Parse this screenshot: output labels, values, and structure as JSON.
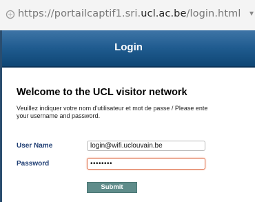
{
  "browser": {
    "url_prefix": "https://portailcaptif1.sri.",
    "url_host": "ucl.ac.be",
    "url_path": "/login.html"
  },
  "header": {
    "title": "Login"
  },
  "welcome": {
    "heading": "Welcome to the UCL visitor network",
    "instructions_line1": "Veuillez indiquer votre nom d'utilisateur et mot de passe / Please ente",
    "instructions_line2": "your username and password."
  },
  "form": {
    "username_label": "User Name",
    "username_value": "login@wifi.uclouvain.be",
    "password_label": "Password",
    "password_value": "••••••••",
    "submit_label": "Submit"
  },
  "colors": {
    "header_blue": "#1f5b8f",
    "label_blue": "#1e3d73",
    "submit_teal": "#5f8c8a",
    "focus_border": "#e07856"
  }
}
